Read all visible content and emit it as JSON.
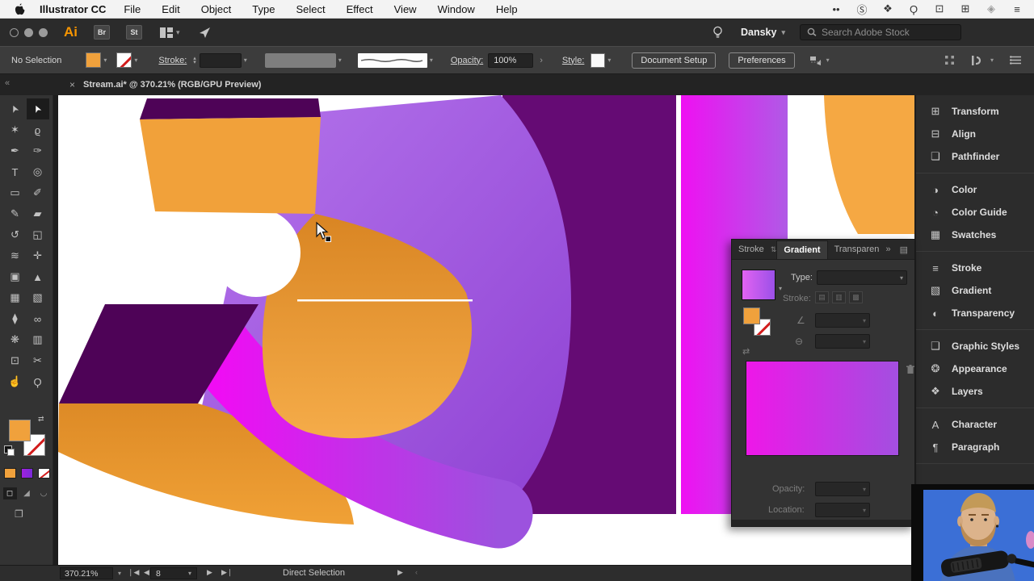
{
  "menu_bar": {
    "app_name": "Illustrator CC",
    "menus": [
      "File",
      "Edit",
      "Object",
      "Type",
      "Select",
      "Effect",
      "View",
      "Window",
      "Help"
    ],
    "status_icons": [
      {
        "name": "more-dots-icon",
        "glyph": "••"
      },
      {
        "name": "skype-icon",
        "glyph": "Ⓢ"
      },
      {
        "name": "dropbox-icon",
        "glyph": "❖"
      },
      {
        "name": "spotlight-search-icon",
        "glyph": "Ϙ"
      },
      {
        "name": "display-icon",
        "glyph": "⊡"
      },
      {
        "name": "app-grid-icon",
        "glyph": "⊞"
      },
      {
        "name": "siri-icon",
        "glyph": "◈"
      },
      {
        "name": "notification-center-icon",
        "glyph": "≡"
      }
    ]
  },
  "title_bar": {
    "ai_logo": "Ai",
    "bridge_label": "Br",
    "stock_label": "St",
    "account_name": "Dansky",
    "search_placeholder": "Search Adobe Stock"
  },
  "control_bar": {
    "selection_status": "No Selection",
    "stroke_label": "Stroke:",
    "opacity_label": "Opacity:",
    "opacity_value": "100%",
    "style_label": "Style:",
    "document_setup_label": "Document Setup",
    "preferences_label": "Preferences"
  },
  "document_tab": {
    "collapse_glyph": "«",
    "close_glyph": "×",
    "title": "Stream.ai* @ 370.21% (RGB/GPU Preview)"
  },
  "toolbar": {
    "fill_color": "#F0A13C",
    "tools": [
      {
        "name": "selection",
        "glyph": "➤",
        "active": false
      },
      {
        "name": "direct-selection",
        "glyph": "➤",
        "active": true
      },
      {
        "name": "magic-wand",
        "glyph": "✶",
        "active": false
      },
      {
        "name": "lasso",
        "glyph": "ϱ",
        "active": false
      },
      {
        "name": "pen",
        "glyph": "✒",
        "active": false
      },
      {
        "name": "curvature",
        "glyph": "✑",
        "active": false
      },
      {
        "name": "type",
        "glyph": "T",
        "active": false
      },
      {
        "name": "spiral",
        "glyph": "◎",
        "active": false
      },
      {
        "name": "rectangle",
        "glyph": "▭",
        "active": false
      },
      {
        "name": "paintbrush",
        "glyph": "✐",
        "active": false
      },
      {
        "name": "shaper",
        "glyph": "✎",
        "active": false
      },
      {
        "name": "eraser",
        "glyph": "▰",
        "active": false
      },
      {
        "name": "rotate",
        "glyph": "↺",
        "active": false
      },
      {
        "name": "scale",
        "glyph": "◱",
        "active": false
      },
      {
        "name": "width",
        "glyph": "≋",
        "active": false
      },
      {
        "name": "free-transform",
        "glyph": "✛",
        "active": false
      },
      {
        "name": "shape-builder",
        "glyph": "▣",
        "active": false
      },
      {
        "name": "perspective-grid",
        "glyph": "▲",
        "active": false
      },
      {
        "name": "mesh",
        "glyph": "▦",
        "active": false
      },
      {
        "name": "gradient",
        "glyph": "▧",
        "active": false
      },
      {
        "name": "eyedropper",
        "glyph": "⧫",
        "active": false
      },
      {
        "name": "blend",
        "glyph": "∞",
        "active": false
      },
      {
        "name": "symbol-sprayer",
        "glyph": "❋",
        "active": false
      },
      {
        "name": "column-graph",
        "glyph": "▥",
        "active": false
      },
      {
        "name": "artboard",
        "glyph": "⊡",
        "active": false
      },
      {
        "name": "slice",
        "glyph": "✂",
        "active": false
      },
      {
        "name": "hand",
        "glyph": "☝",
        "active": false
      },
      {
        "name": "zoom",
        "glyph": "Ϙ",
        "active": false
      }
    ]
  },
  "artwork": {
    "orange": "#F1A13A",
    "orange_deep": "#DD8A26",
    "violet_light": "#B575EC",
    "violet_deep": "#8E41D3",
    "magenta": "#F00CF4",
    "dark_purple_rect": "#650B74",
    "plum_slab": "#4E0357",
    "guide_line": "#FFFFFF"
  },
  "gradient_panel": {
    "tabs": [
      {
        "label": "Stroke",
        "active": false
      },
      {
        "label": "Gradient",
        "active": true
      },
      {
        "label": "Transparen",
        "active": false
      }
    ],
    "sort_glyph": "⇅",
    "expand_glyph": "»",
    "type_label": "Type:",
    "stroke_label": "Stroke:",
    "angle_glyph": "∠",
    "aspect_glyph": "⊖",
    "reverse_glyph": "⇄",
    "opacity_label": "Opacity:",
    "location_label": "Location:",
    "gradient_start": "#EE17E8",
    "gradient_end": "#A34FE0"
  },
  "panel_dock": {
    "groups": [
      [
        {
          "icon": "transform-icon",
          "glyph": "⊞",
          "label": "Transform"
        },
        {
          "icon": "align-icon",
          "glyph": "⊟",
          "label": "Align"
        },
        {
          "icon": "pathfinder-icon",
          "glyph": "❏",
          "label": "Pathfinder"
        }
      ],
      [
        {
          "icon": "color-icon",
          "glyph": "◑",
          "label": "Color"
        },
        {
          "icon": "color-guide-icon",
          "glyph": "◔",
          "label": "Color Guide"
        },
        {
          "icon": "swatches-icon",
          "glyph": "▦",
          "label": "Swatches"
        }
      ],
      [
        {
          "icon": "stroke-icon",
          "glyph": "≡",
          "label": "Stroke"
        },
        {
          "icon": "gradient-icon",
          "glyph": "▧",
          "label": "Gradient"
        },
        {
          "icon": "transparency-icon",
          "glyph": "◐",
          "label": "Transparency"
        }
      ],
      [
        {
          "icon": "graphic-styles-icon",
          "glyph": "❑",
          "label": "Graphic Styles"
        },
        {
          "icon": "appearance-icon",
          "glyph": "❂",
          "label": "Appearance"
        },
        {
          "icon": "layers-icon",
          "glyph": "❖",
          "label": "Layers"
        }
      ],
      [
        {
          "icon": "character-icon",
          "glyph": "A",
          "label": "Character"
        },
        {
          "icon": "paragraph-icon",
          "glyph": "¶",
          "label": "Paragraph"
        }
      ]
    ]
  },
  "status_bar": {
    "zoom_level": "370.21%",
    "artboard_value": "8",
    "tool_name": "Direct Selection"
  }
}
